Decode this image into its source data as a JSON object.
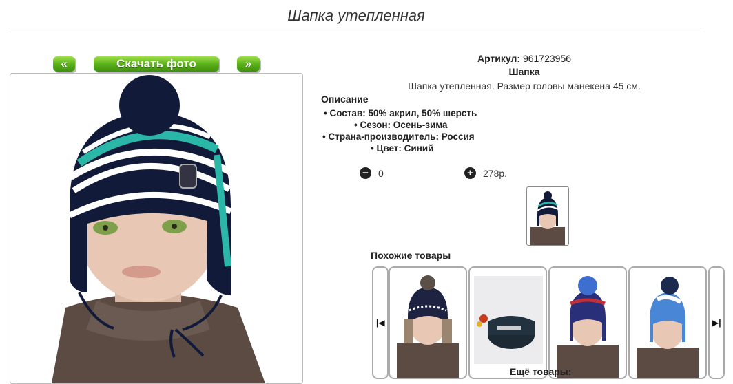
{
  "page": {
    "title": "Шапка утепленная"
  },
  "photo_nav": {
    "prev": "«",
    "download": "Скачать фото",
    "next": "»"
  },
  "product": {
    "article_label": "Артикул:",
    "article_value": "961723956",
    "type": "Шапка",
    "short_desc": "Шапка утепленная. Размер головы манекена 45 см.",
    "description_heading": "Описание",
    "specs": [
      "Состав: 50% акрил, 50% шерсть",
      "Сезон: Осень-зима",
      "Страна-производитель: Россия",
      "Цвет: Синий"
    ]
  },
  "cart": {
    "minus_icon": "minus-circle-icon",
    "quantity": "0",
    "plus_icon": "plus-circle-icon",
    "price": "278р."
  },
  "similar": {
    "heading": "Похожие товары",
    "prev_icon": "skip-back-icon",
    "next_icon": "skip-forward-icon",
    "more_label": "Ещё товары:"
  },
  "colors": {
    "accent_green": "#5cb21c",
    "hat_navy": "#121a3a",
    "hat_teal": "#2bb7a8"
  }
}
